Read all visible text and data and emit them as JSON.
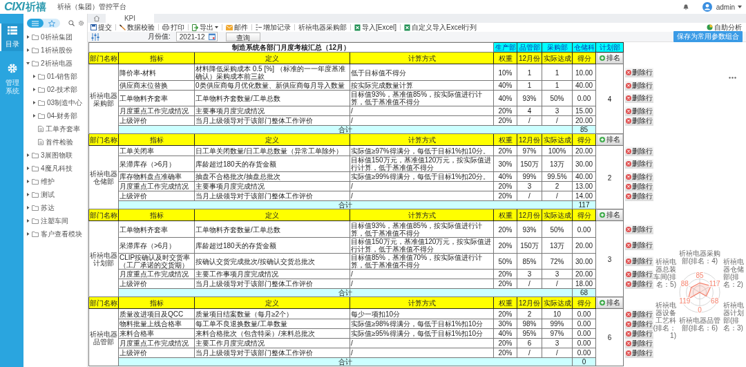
{
  "header": {
    "logo_mark": "CIXI",
    "logo_name": "祈禧",
    "title": "祈禧（集团）管控平台",
    "user": "admin"
  },
  "rail": [
    {
      "label": "目录",
      "selected": true
    },
    {
      "label": "管理系统",
      "selected": false
    }
  ],
  "sidebar": {
    "modes": [
      {
        "selected": true
      },
      {
        "selected": false
      }
    ],
    "tree": [
      {
        "label": "0祈禧集团",
        "expanded": false,
        "kind": "folder"
      },
      {
        "label": "1祈禧股份",
        "expanded": false,
        "kind": "folder"
      },
      {
        "label": "2祈禧电器",
        "expanded": true,
        "kind": "folder",
        "children": [
          {
            "label": "01-销售部",
            "expanded": false,
            "kind": "folder"
          },
          {
            "label": "02-技术部",
            "expanded": false,
            "kind": "folder"
          },
          {
            "label": "03制造中心",
            "expanded": false,
            "kind": "folder"
          },
          {
            "label": "04-财务部",
            "expanded": false,
            "kind": "folder"
          },
          {
            "label": "工单齐套率",
            "kind": "doc"
          },
          {
            "label": "首件检验",
            "kind": "doc"
          }
        ]
      },
      {
        "label": "3展图物联",
        "expanded": false,
        "kind": "folder"
      },
      {
        "label": "4魔凡科技",
        "expanded": false,
        "kind": "folder"
      },
      {
        "label": "维护",
        "expanded": false,
        "kind": "folder"
      },
      {
        "label": "测试",
        "expanded": false,
        "kind": "folder"
      },
      {
        "label": "苏达",
        "expanded": false,
        "kind": "folder"
      },
      {
        "label": "注塑车间",
        "expanded": false,
        "kind": "folder"
      },
      {
        "label": "客户查看模块",
        "expanded": false,
        "kind": "folder"
      }
    ]
  },
  "tabs": [
    {
      "label": "KPI",
      "selected": true
    }
  ],
  "toolbar": [
    {
      "label": "提交"
    },
    {
      "label": "数据校验"
    },
    {
      "label": "打印"
    },
    {
      "label": "导出",
      "dropdown": true
    },
    {
      "label": "邮件"
    },
    {
      "label": "增加记录"
    },
    {
      "label": "祈禧电器采购部"
    },
    {
      "label": "导入[Excel]"
    },
    {
      "label": "自定义导入Excel行列"
    }
  ],
  "self_analysis": "自助分析",
  "save_button": "保存为常用参数组合",
  "params": {
    "label": "月份值:",
    "value": "2021-12",
    "query": "查询"
  },
  "report": {
    "title": "制造系统各部门月度考核汇总（12月）",
    "dept_links": [
      "生产部",
      "品管部",
      "采购部",
      "仓储科",
      "计划部"
    ],
    "sections": [
      {
        "columns": [
          "部门名称",
          "指标",
          "定义",
          "计算方式",
          "权重",
          "12月份",
          "实际达成",
          "得分"
        ],
        "rank_button": "排名",
        "dept": "祈禧电器采购部",
        "rank": "4",
        "total_label": "合计",
        "total": "85",
        "rows": [
          {
            "indicator": "降价率-材料",
            "definition": "材料降低采购成本 0.5 [%] （标准的一一年度基准确认）采购成本前三款",
            "method": "低于目标值不得分",
            "weight": "10%",
            "month": "1",
            "actual": "1",
            "score": "10.00",
            "delete": "删除行"
          },
          {
            "indicator": "供应商末位替换",
            "definition": "0类供应商每月优化数量、新供应商每月导入数量",
            "method": "按实际完成数量计算",
            "weight": "40%",
            "month": "1",
            "actual": "1",
            "score": "40.00",
            "delete": "删除行"
          },
          {
            "indicator": "工单物料齐套率",
            "definition": "工单物料齐套数量/工单总数",
            "method": "目标值93%，基准值85%，按实际值进行计算，低于基准值不得分",
            "weight": "40%",
            "month": "93%",
            "actual": "50%",
            "score": "0.00",
            "delete": "删除行"
          },
          {
            "indicator": "月度重点工作完成情况",
            "definition": "主要事项月度完成情况",
            "method": "/",
            "weight": "20%",
            "month": "4",
            "actual": "3",
            "score": "15.00",
            "delete": "删除行"
          },
          {
            "indicator": "上级评价",
            "definition": "当月上级领导对于该部门整体工作评价",
            "method": "/",
            "weight": "20%",
            "month": "/",
            "actual": "/",
            "score": "20.00",
            "delete": "删除行"
          }
        ]
      },
      {
        "columns": [
          "部门名称",
          "指标",
          "定义",
          "计算方式",
          "权重",
          "12月份",
          "实际达成",
          "得分"
        ],
        "rank_button": "排名",
        "dept": "祈禧电器仓储部",
        "rank": "2",
        "total_label": "合计",
        "total": "117",
        "rows": [
          {
            "indicator": "工单关闭率",
            "definition": "日工单关闭数量/日工单总数量（异常工单除外）",
            "method": "实际值≥97%得满分，每低于目标1%扣10分。",
            "weight": "20%",
            "month": "97%",
            "actual": "100%",
            "score": "20.00",
            "delete": "删除行"
          },
          {
            "indicator": "呆滞库存（>6月）",
            "definition": "库龄超过180天的存货金额",
            "method": "目标值150万元，基准值120万元，按实际值进行计算，低于基准值不得分",
            "weight": "30%",
            "month": "150万",
            "actual": "13万",
            "score": "30.00",
            "delete": "删除行"
          },
          {
            "indicator": "库存物料盘点准确率",
            "definition": "抽盘不合格批次/抽盘总批次",
            "method": "实际值≥99%得满分，每低于目标1%扣20分。",
            "weight": "40%",
            "month": "99%",
            "actual": "99.5%",
            "score": "40.00",
            "delete": "删除行"
          },
          {
            "indicator": "月度重点工作完成情况",
            "definition": "主要事项月度完成情况",
            "method": "/",
            "weight": "20%",
            "month": "3",
            "actual": "2",
            "score": "13.00",
            "delete": "删除行"
          },
          {
            "indicator": "上级评价",
            "definition": "当月上级领导对于该部门整体工作评价",
            "method": "/",
            "weight": "20%",
            "month": "/",
            "actual": "/",
            "score": "14.00",
            "delete": "删除行"
          }
        ]
      },
      {
        "columns": [
          "部门名称",
          "指标",
          "定义",
          "计算方式",
          "权重",
          "12月份",
          "实际达成",
          "得分"
        ],
        "rank_button": "排名",
        "dept": "祈禧电器计划部",
        "rank": "3",
        "total_label": "合计",
        "total": "68",
        "rows": [
          {
            "indicator": "工单物料齐套率",
            "definition": "工单物料齐套数量/工单总数",
            "method": "目标值93%，基准值85%，按实际值进行计算，低于基准值不得分",
            "weight": "20%",
            "month": "93%",
            "actual": "50%",
            "score": "0.00",
            "delete": "删除行"
          },
          {
            "indicator": "呆滞库存（>6月）",
            "definition": "库龄超过180天的存货金额",
            "method": "目标值150万元，基准值120万元，按实际值进行计算，低于基准值不得分",
            "weight": "20%",
            "month": "150万",
            "actual": "13万",
            "score": "20.00",
            "delete": "删除行"
          },
          {
            "indicator": "CLIP按确认及时交货率（工厂承诺的交货期）",
            "definition": "按确认交货完成批次/按确认交货总批次",
            "method": "目标值85%，基准值70%，按实际值进行计算，低于基准值不得分",
            "weight": "50%",
            "month": "85%",
            "actual": "72%",
            "score": "30.00",
            "delete": "删除行"
          },
          {
            "indicator": "月度重点工作完成情况",
            "definition": "主要工作事项月度完成情况",
            "method": "/",
            "weight": "20%",
            "month": "3",
            "actual": "3",
            "score": "20.00",
            "delete": "删除行"
          },
          {
            "indicator": "上级评价",
            "definition": "当月上级领导对于该部门整体工作评价",
            "method": "/",
            "weight": "20%",
            "month": "/",
            "actual": "/",
            "score": "18.00",
            "delete": "删除行"
          }
        ]
      },
      {
        "columns": [
          "部门名称",
          "指标",
          "定义",
          "计算方式",
          "权重",
          "12月份",
          "实际达成",
          "得分"
        ],
        "rank_button": "排名",
        "dept": "祈禧电器品管部",
        "rank": "6",
        "total_label": "合计",
        "total": "0",
        "rows": [
          {
            "indicator": "质量改进项目及QCC",
            "definition": "质量项目结案数量（每月≥2个）",
            "method": "每少一项扣10分",
            "weight": "20%",
            "month": "2",
            "actual": "10",
            "score": "0.00",
            "delete": "删除行"
          },
          {
            "indicator": "物料批量上线合格率",
            "definition": "每工单不良退换数量/工单数量",
            "method": "实际值≥98%得满分，每低于目标1%扣10分",
            "weight": "30%",
            "month": "98%",
            "actual": "99%",
            "score": "0.00",
            "delete": "删除行"
          },
          {
            "indicator": "来料合格率",
            "definition": "来料合格批次（包含特采）/来料总批次",
            "method": "实际值≥95%得满分，每低于目标1%扣10分",
            "weight": "40%",
            "month": "95%",
            "actual": "97%",
            "score": "0.00",
            "delete": "删除行"
          },
          {
            "indicator": "月度重点工作完成情况",
            "definition": "主要工作月度完成情况",
            "method": "/",
            "weight": "20%",
            "month": "6",
            "actual": "3",
            "score": "0.00",
            "delete": "删除行"
          },
          {
            "indicator": "上级评价",
            "definition": "当月上级领导对于该部门整体工作评价",
            "method": "/",
            "weight": "20%",
            "month": "/",
            "actual": "/",
            "score": "0.00",
            "delete": "删除行"
          }
        ]
      }
    ]
  },
  "radar": {
    "color": "#f4826e",
    "axes": [
      {
        "label": "祈禧电器采购部(排名：4)",
        "value": "85"
      },
      {
        "label": "祈禧电器总装车间(排名：5)",
        "value": "88"
      },
      {
        "label": "祈禧电器仓储部(排名：2)",
        "value": "117"
      },
      {
        "label": "祈禧电器设备工艺科(排名：1)",
        "value": "119"
      },
      {
        "label": "祈禧电器品管部(排名：6)",
        "value": "0"
      },
      {
        "label": "祈禧电器计划部(排名：3)",
        "value": "68"
      }
    ]
  }
}
